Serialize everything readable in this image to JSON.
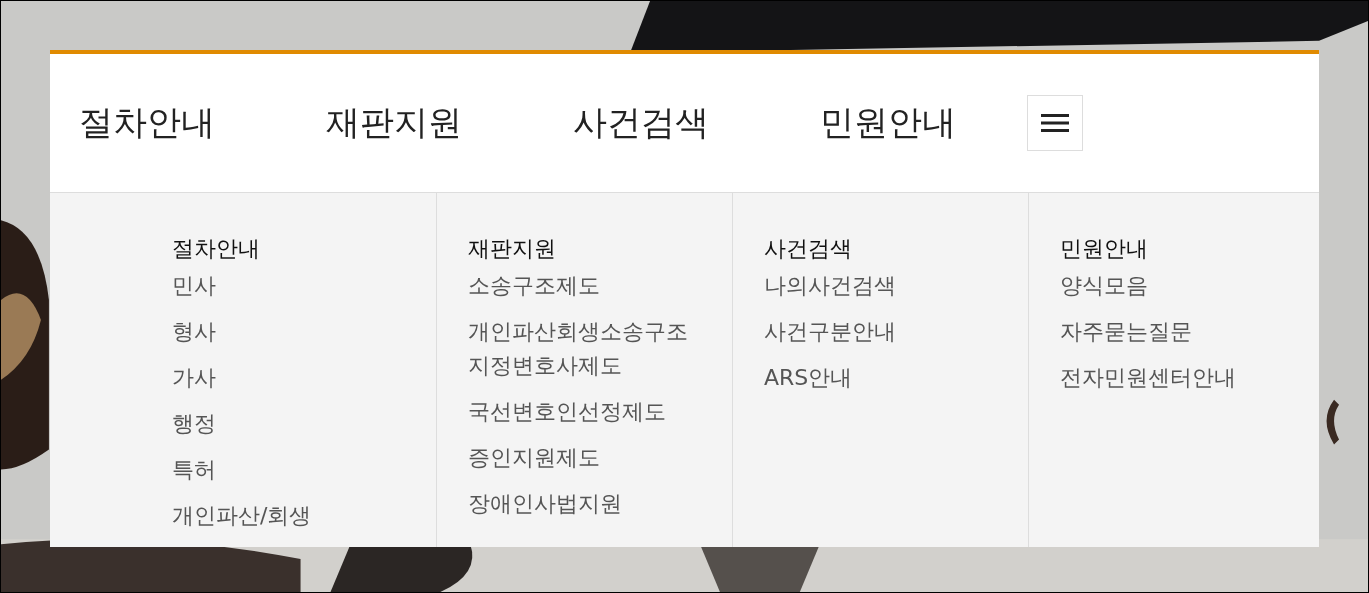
{
  "nav": {
    "items": [
      {
        "label": "절차안내"
      },
      {
        "label": "재판지원"
      },
      {
        "label": "사건검색"
      },
      {
        "label": "민원안내"
      }
    ]
  },
  "menu": {
    "columns": [
      {
        "title": "절차안내",
        "items": [
          "민사",
          "형사",
          "가사",
          "행정",
          "특허",
          "개인파산/회생"
        ]
      },
      {
        "title": "재판지원",
        "items": [
          "소송구조제도",
          "개인파산회생소송구조지정변호사제도",
          "국선변호인선정제도",
          "증인지원제도",
          "장애인사법지원"
        ]
      },
      {
        "title": "사건검색",
        "items": [
          "나의사건검색",
          "사건구분안내",
          "ARS안내"
        ]
      },
      {
        "title": "민원안내",
        "items": [
          "양식모음",
          "자주묻는질문",
          "전자민원센터안내"
        ]
      }
    ]
  }
}
